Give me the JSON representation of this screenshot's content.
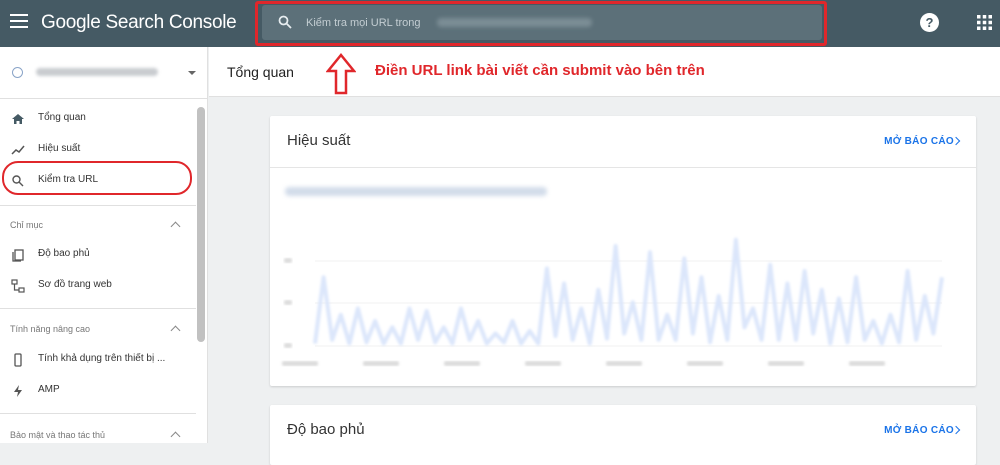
{
  "app": {
    "title": "Google Search Console",
    "search_placeholder": "Kiểm tra mọi URL trong"
  },
  "sidebar": {
    "items_top": [
      {
        "label": "Tổng quan",
        "icon": "home-icon"
      },
      {
        "label": "Hiệu suất",
        "icon": "trending-icon"
      },
      {
        "label": "Kiểm tra URL",
        "icon": "search-icon"
      }
    ],
    "section_index": {
      "label": "Chỉ mục",
      "items": [
        {
          "label": "Độ bao phủ",
          "icon": "copy-icon"
        },
        {
          "label": "Sơ đồ trang web",
          "icon": "sitemap-icon"
        }
      ]
    },
    "section_enhancements": {
      "label": "Tính năng nâng cao",
      "items": [
        {
          "label": "Tính khả dụng trên thiết bị ...",
          "icon": "phone-icon"
        },
        {
          "label": "AMP",
          "icon": "bolt-icon"
        }
      ]
    },
    "section_security": {
      "label": "Bảo mật và thao tác thủ"
    }
  },
  "header": {
    "page_title": "Tổng quan",
    "annotation": "Điền URL link bài viết cần submit vào bên trên"
  },
  "cards": [
    {
      "title": "Hiệu suất",
      "link": "MỞ BÁO CÁO"
    },
    {
      "title": "Độ bao phủ",
      "link": "MỞ BÁO CÁO"
    }
  ],
  "colors": {
    "topbar": "#455a64",
    "highlight": "#e0272b",
    "link": "#1a73e8",
    "chart_line": "#dbe6fb"
  },
  "chart_data": {
    "type": "line",
    "title": "",
    "xlabel": "",
    "ylabel": "",
    "ylim": [
      0,
      1
    ],
    "series": [
      {
        "values": [
          0.02,
          0.55,
          0.05,
          0.25,
          0.02,
          0.3,
          0.03,
          0.2,
          0.02,
          0.15,
          0.02,
          0.3,
          0.05,
          0.28,
          0.03,
          0.15,
          0.02,
          0.3,
          0.05,
          0.2,
          0.02,
          0.1,
          0.03,
          0.2,
          0.02,
          0.12,
          0.02,
          0.62,
          0.08,
          0.5,
          0.05,
          0.3,
          0.02,
          0.45,
          0.06,
          0.8,
          0.1,
          0.35,
          0.05,
          0.75,
          0.05,
          0.25,
          0.05,
          0.7,
          0.1,
          0.55,
          0.03,
          0.4,
          0.05,
          0.85,
          0.15,
          0.3,
          0.05,
          0.65,
          0.05,
          0.5,
          0.05,
          0.6,
          0.1,
          0.45,
          0.02,
          0.38,
          0.03,
          0.55,
          0.05,
          0.2,
          0.02,
          0.25,
          0.03,
          0.6,
          0.05,
          0.4,
          0.1,
          0.55
        ]
      }
    ]
  }
}
